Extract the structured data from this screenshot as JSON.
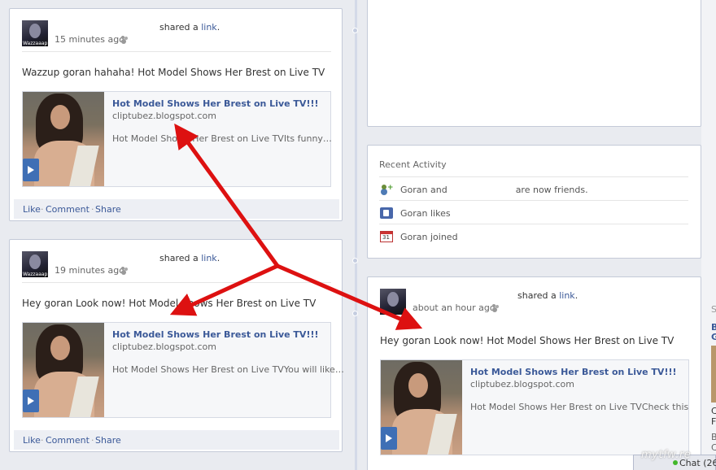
{
  "posts": [
    {
      "avatar_tag": "Wazzaaap",
      "shared_prefix": "shared a ",
      "shared_link": "link",
      "shared_suffix": ".",
      "timestamp": "15 minutes ago",
      "message": "Wazzup goran hahaha! Hot Model Shows Her Brest on Live TV",
      "link_title": "Hot Model Shows Her Brest on Live TV!!!",
      "link_domain": "cliptubez.blogspot.com",
      "link_desc": "Hot Model Shows Her Brest on Live TVIts funny…",
      "actions": {
        "like": "Like",
        "comment": "Comment",
        "share": "Share",
        "sep": "·"
      }
    },
    {
      "avatar_tag": "Wazzaaap",
      "shared_prefix": "shared a ",
      "shared_link": "link",
      "shared_suffix": ".",
      "timestamp": "19 minutes ago",
      "message": "Hey goran Look now! Hot Model Shows Her Brest on Live TV",
      "link_title": "Hot Model Shows Her Brest on Live TV!!!",
      "link_domain": "cliptubez.blogspot.com",
      "link_desc": "Hot Model Shows Her Brest on Live TVYou will like…",
      "actions": {
        "like": "Like",
        "comment": "Comment",
        "share": "Share",
        "sep": "·"
      }
    },
    {
      "avatar_tag": "",
      "shared_prefix": "shared a ",
      "shared_link": "link",
      "shared_suffix": ".",
      "timestamp": "about an hour ago",
      "message": "Hey goran Look now! Hot Model Shows Her Brest on Live TV",
      "link_title": "Hot Model Shows Her Brest on Live TV!!!",
      "link_domain": "cliptubez.blogspot.com",
      "link_desc": "Hot Model Shows Her Brest on Live TVCheck this"
    }
  ],
  "recent_activity": {
    "title": "Recent Activity",
    "items": [
      {
        "icon": "friends-icon",
        "text": "Goran and",
        "text_after": "are now friends."
      },
      {
        "icon": "like-icon",
        "text": "Goran likes"
      },
      {
        "icon": "calendar-icon",
        "text": "Goran joined"
      }
    ]
  },
  "right_rail": {
    "letter_s": "S",
    "letter_b": "B",
    "letter_g": "G",
    "letter_c": "C",
    "letter_f": "F",
    "letter_b2": "B",
    "letter_c2": "C"
  },
  "chat": {
    "label": "Chat (26"
  },
  "watermark": "mytfw.re",
  "colors": {
    "link": "#3b5998",
    "arrow": "#dd1111",
    "background": "#e9ebf0"
  }
}
